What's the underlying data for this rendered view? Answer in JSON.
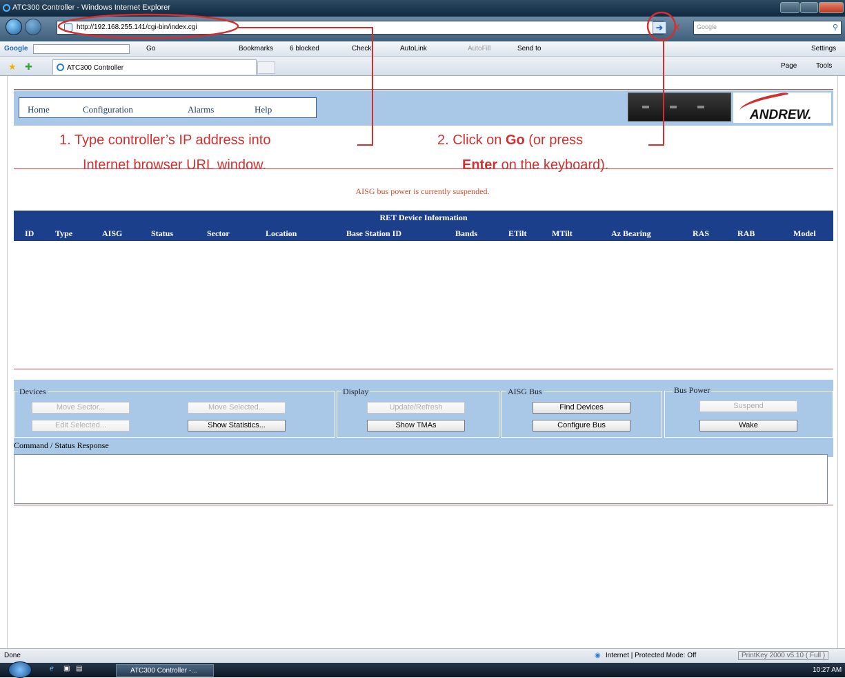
{
  "window": {
    "title": "ATC300 Controller - Windows Internet Explorer"
  },
  "address_bar": {
    "url": "http://192.168.255.141/cgi-bin/index.cgi",
    "go_icon": "go-arrow-icon",
    "search_placeholder": "Google"
  },
  "google_toolbar": {
    "brand": "Google",
    "go": "Go",
    "bookmarks": "Bookmarks",
    "blocked": "6 blocked",
    "check": "Check",
    "autolink": "AutoLink",
    "autofill": "AutoFill",
    "sendto": "Send to",
    "settings": "Settings"
  },
  "tab": {
    "label": "ATC300 Controller"
  },
  "commandbar": {
    "page": "Page",
    "tools": "Tools"
  },
  "nav": {
    "home": "Home",
    "configuration": "Configuration",
    "alarms": "Alarms",
    "help": "Help"
  },
  "logo": {
    "text": "ANDREW."
  },
  "annotations": {
    "step1_line1": "1.  Type controller’s IP address into",
    "step1_line2": "Internet browser URL window.",
    "step2_prefix": "2.  Click on ",
    "step2_go": "Go",
    "step2_suffix": " (or press",
    "step2_enter": "Enter",
    "step2_line2_rest": " on the keyboard)."
  },
  "status_message": "AISG bus power is currently suspended.",
  "ret_table": {
    "title": "RET Device Information",
    "columns": [
      "ID",
      "Type",
      "AISG",
      "Status",
      "Sector",
      "Location",
      "Base Station ID",
      "Bands",
      "ETilt",
      "MTilt",
      "Az Bearing",
      "RAS",
      "RAB",
      "Model"
    ]
  },
  "controls": {
    "devices": {
      "label": "Devices",
      "move_sector": "Move Sector...",
      "move_selected": "Move Selected...",
      "edit_selected": "Edit Selected...",
      "show_statistics": "Show Statistics..."
    },
    "display": {
      "label": "Display",
      "update_refresh": "Update/Refresh",
      "show_tmas": "Show TMAs"
    },
    "aisg_bus": {
      "label": "AISG Bus",
      "find_devices": "Find Devices",
      "configure_bus": "Configure Bus"
    },
    "bus_power": {
      "label": "Bus Power",
      "suspend": "Suspend",
      "wake": "Wake"
    }
  },
  "command_status": {
    "label": "Command / Status Response",
    "value": ""
  },
  "statusbar": {
    "left": "Done",
    "zone": "Internet | Protected Mode: Off",
    "printkey": "PrintKey 2000  v5.10 ( Full )"
  },
  "taskbar": {
    "task": "ATC300 Controller -...",
    "clock": "10:27 AM"
  },
  "colors": {
    "header_band": "#a9c7e6",
    "table_header": "#1c3f8c",
    "annotation_red": "#d32f2f"
  }
}
